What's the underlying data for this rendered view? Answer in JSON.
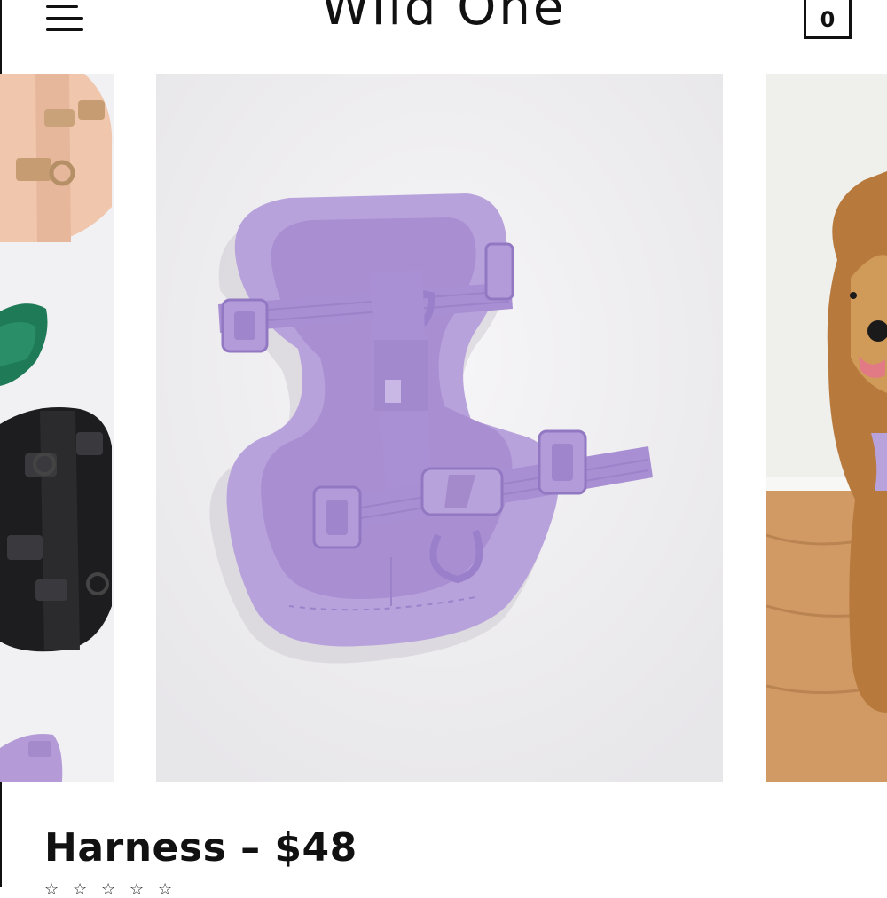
{
  "header": {
    "brand": "Wild One",
    "cart_count": "0",
    "icons": {
      "menu": "hamburger-menu-icon",
      "cart": "shopping-bag-icon"
    }
  },
  "gallery": {
    "slides": [
      {
        "name": "harness-colorways-image"
      },
      {
        "name": "lavender-harness-image"
      },
      {
        "name": "dog-wearing-harness-image"
      }
    ],
    "active_index": 1
  },
  "product": {
    "title": "Harness – $48",
    "rating_stars": 5
  },
  "colors": {
    "text": "#111111",
    "lavender": "#b49bd8",
    "background": "#ffffff"
  }
}
